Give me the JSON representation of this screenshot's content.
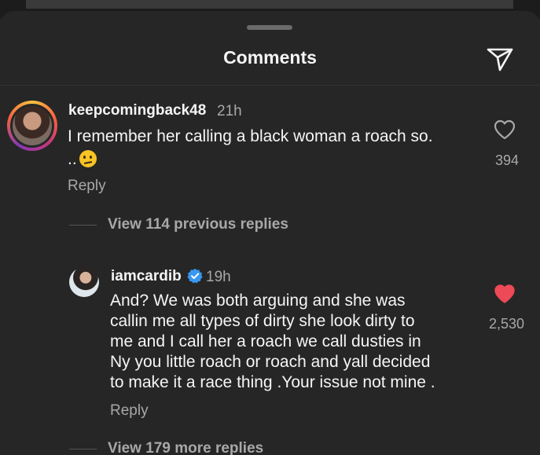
{
  "header": {
    "title": "Comments"
  },
  "comments": [
    {
      "username": "keepcomingback48",
      "time": "21h",
      "text_line1": "I remember her calling a black woman a roach so.",
      "text_line2": "..",
      "likes": "394",
      "reply_label": "Reply",
      "liked": false
    }
  ],
  "thread": {
    "view_previous_label": "View 114 previous replies",
    "reply": {
      "username": "iamcardib",
      "verified": true,
      "time": "19h",
      "text": "And? We was both arguing and she was\ncallin me all types of dirty she look dirty to\nme and I call her a roach we call dusties in\nNy you little roach or roach and yall decided\nto make it a race thing .Your issue not mine .",
      "likes": "2,530",
      "liked": true,
      "reply_label": "Reply"
    },
    "view_more_label": "View 179 more replies"
  },
  "colors": {
    "background": "#262626",
    "liked_heart": "#ed4956",
    "verified": "#3897f0",
    "secondary_text": "#a8a8a8"
  },
  "icons": [
    "share-icon",
    "heart-icon",
    "heart-filled-icon",
    "verified-badge-icon",
    "emoji-icon"
  ]
}
